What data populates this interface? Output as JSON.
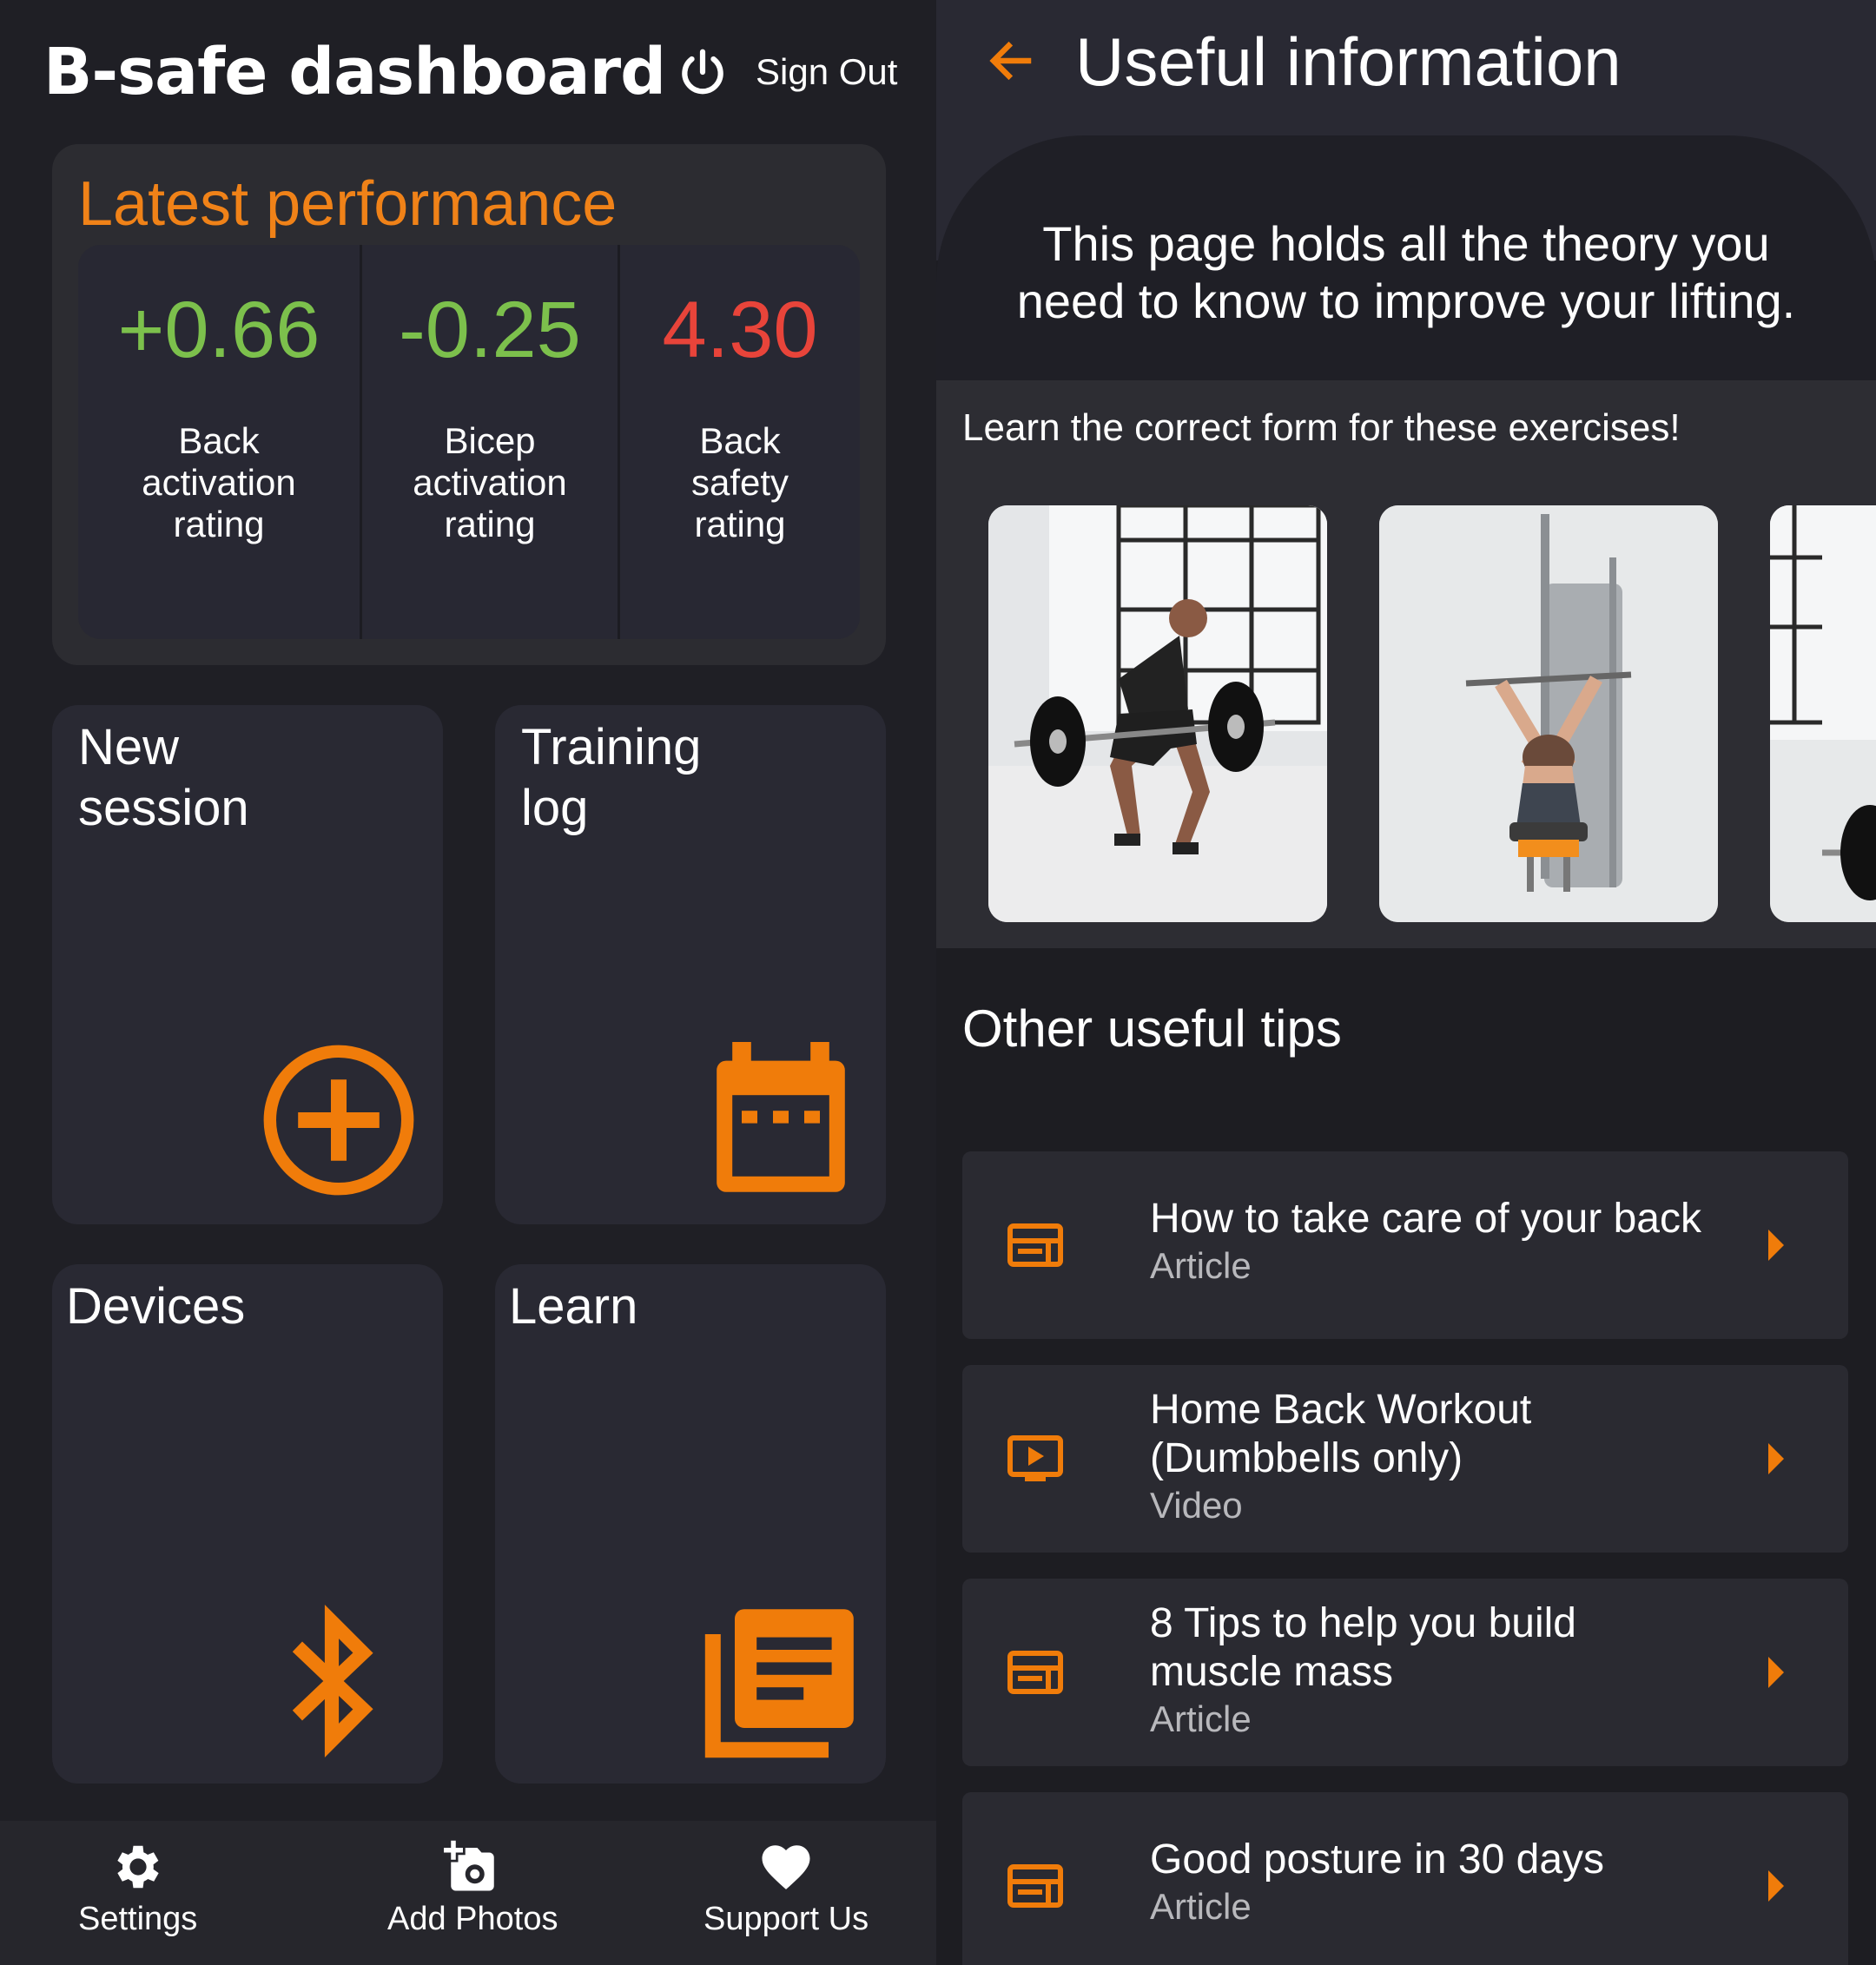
{
  "dashboard": {
    "title": "B-safe dashboard",
    "sign_out_label": "Sign Out",
    "performance": {
      "title": "Latest performance",
      "metrics": [
        {
          "value": "+0.66",
          "label": "Back\nactivation\nrating",
          "color": "#7cc04c"
        },
        {
          "value": "-0.25",
          "label": "Bicep\nactivation\nrating",
          "color": "#7cc04c"
        },
        {
          "value": "4.30",
          "label": "Back\nsafety\nrating",
          "color": "#e8443a"
        }
      ]
    },
    "tiles": {
      "new_session": "New\nsession",
      "training_log": "Training\nlog",
      "devices": "Devices",
      "learn": "Learn"
    },
    "bottom_nav": {
      "settings": "Settings",
      "add_photos": "Add Photos",
      "support_us": "Support Us"
    },
    "accent_color": "#f07c0a"
  },
  "useful_info": {
    "title": "Useful information",
    "intro": "This page holds all the theory you\nneed to know to improve your lifting.",
    "exercises_heading": "Learn the correct form for these exercises!",
    "exercise_images": [
      "barbell-row-photo",
      "lat-pulldown-photo",
      "barbell-photo"
    ],
    "tips_heading": "Other useful tips",
    "tips": [
      {
        "title": "How to take care of your back",
        "type": "Article",
        "icon": "article-icon"
      },
      {
        "title": "Home Back Workout\n(Dumbbells only)",
        "type": "Video",
        "icon": "video-icon"
      },
      {
        "title": "8 Tips to help you build\nmuscle mass",
        "type": "Article",
        "icon": "article-icon"
      },
      {
        "title": "Good posture in 30 days",
        "type": "Article",
        "icon": "article-icon"
      }
    ]
  }
}
